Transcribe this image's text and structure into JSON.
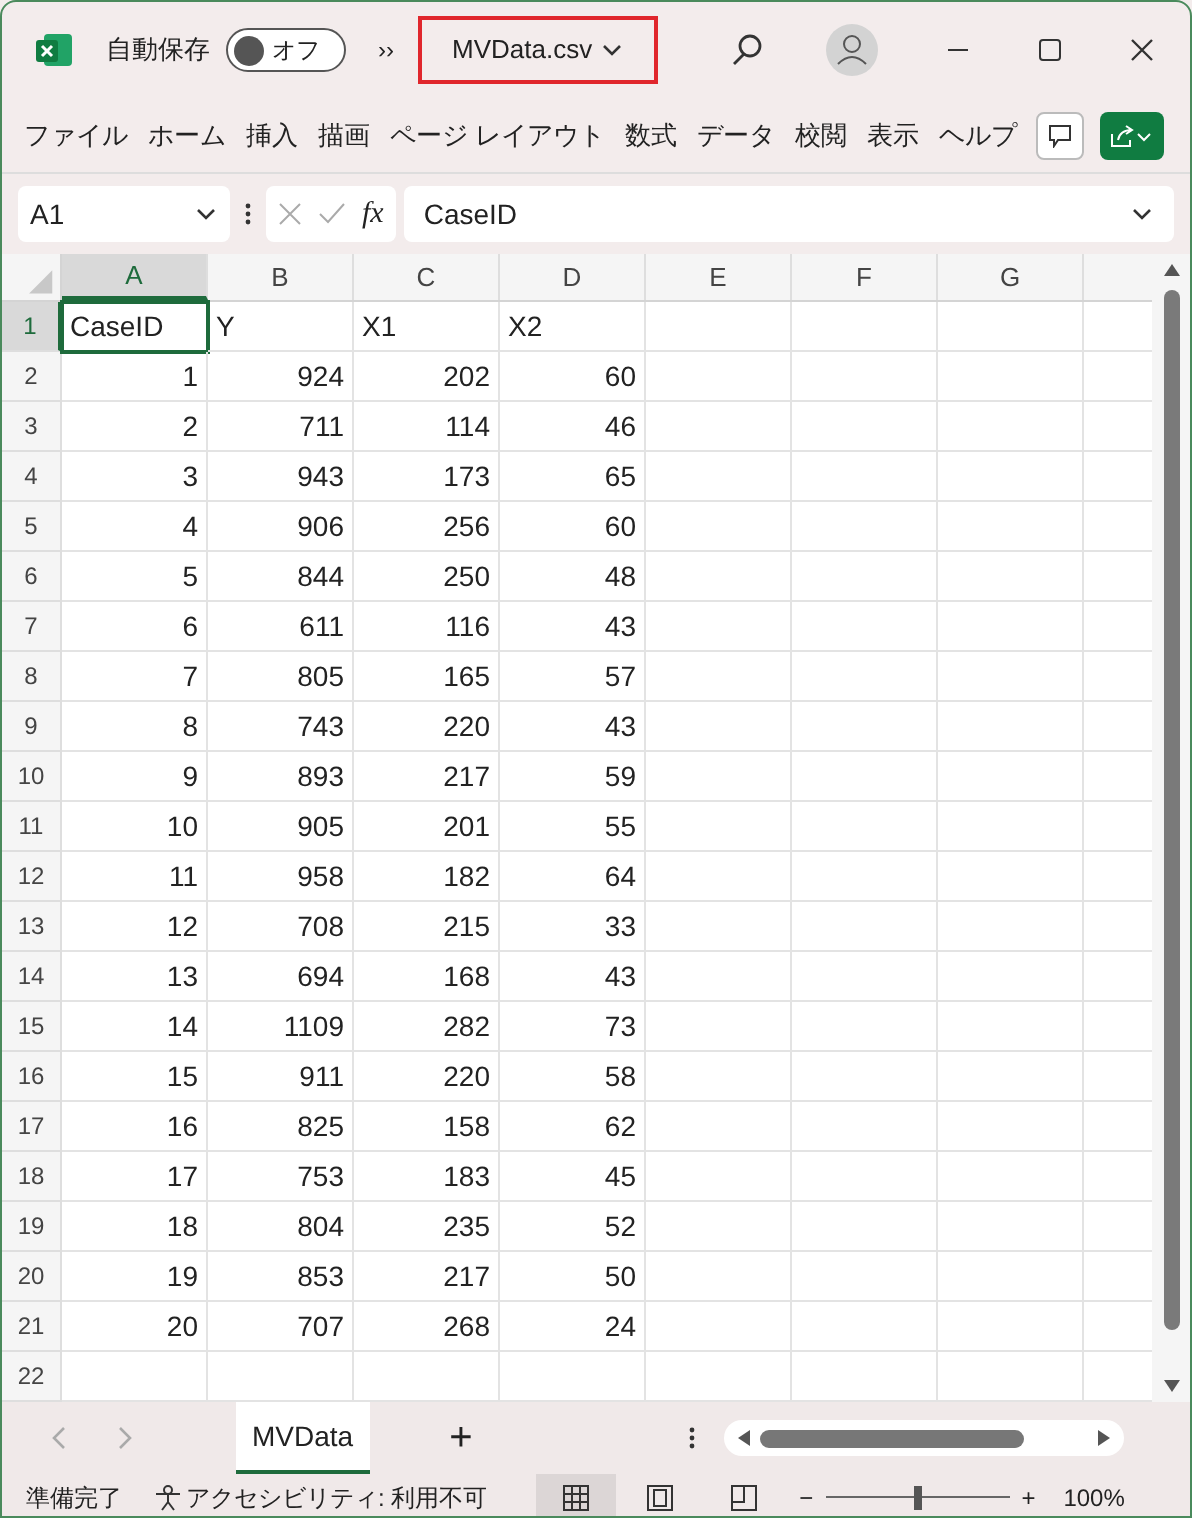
{
  "title_bar": {
    "autosave": {
      "label": "自動保存",
      "state_text": "オフ",
      "on": false
    },
    "overflow": "››",
    "file_name": "MVData.csv"
  },
  "ribbon_tabs": [
    {
      "label": "ファイル"
    },
    {
      "label": "ホーム"
    },
    {
      "label": "挿入"
    },
    {
      "label": "描画"
    },
    {
      "label": "ページ レイアウト"
    },
    {
      "label": "数式"
    },
    {
      "label": "データ"
    },
    {
      "label": "校閲"
    },
    {
      "label": "表示"
    },
    {
      "label": "ヘルプ"
    }
  ],
  "formula_bar": {
    "name_box": "A1",
    "fx": "fx",
    "formula": "CaseID"
  },
  "columns": [
    {
      "label": "A",
      "selected": true
    },
    {
      "label": "B",
      "selected": false
    },
    {
      "label": "C",
      "selected": false
    },
    {
      "label": "D",
      "selected": false
    },
    {
      "label": "E",
      "selected": false
    },
    {
      "label": "F",
      "selected": false
    },
    {
      "label": "G",
      "selected": false
    }
  ],
  "rows": [
    {
      "header": "1",
      "selected": true,
      "kind": "text",
      "cells": [
        "CaseID",
        "Y",
        "X1",
        "X2"
      ]
    },
    {
      "header": "2",
      "selected": false,
      "kind": "number",
      "cells": [
        "1",
        "924",
        "202",
        "60"
      ]
    },
    {
      "header": "3",
      "selected": false,
      "kind": "number",
      "cells": [
        "2",
        "711",
        "114",
        "46"
      ]
    },
    {
      "header": "4",
      "selected": false,
      "kind": "number",
      "cells": [
        "3",
        "943",
        "173",
        "65"
      ]
    },
    {
      "header": "5",
      "selected": false,
      "kind": "number",
      "cells": [
        "4",
        "906",
        "256",
        "60"
      ]
    },
    {
      "header": "6",
      "selected": false,
      "kind": "number",
      "cells": [
        "5",
        "844",
        "250",
        "48"
      ]
    },
    {
      "header": "7",
      "selected": false,
      "kind": "number",
      "cells": [
        "6",
        "611",
        "116",
        "43"
      ]
    },
    {
      "header": "8",
      "selected": false,
      "kind": "number",
      "cells": [
        "7",
        "805",
        "165",
        "57"
      ]
    },
    {
      "header": "9",
      "selected": false,
      "kind": "number",
      "cells": [
        "8",
        "743",
        "220",
        "43"
      ]
    },
    {
      "header": "10",
      "selected": false,
      "kind": "number",
      "cells": [
        "9",
        "893",
        "217",
        "59"
      ]
    },
    {
      "header": "11",
      "selected": false,
      "kind": "number",
      "cells": [
        "10",
        "905",
        "201",
        "55"
      ]
    },
    {
      "header": "12",
      "selected": false,
      "kind": "number",
      "cells": [
        "11",
        "958",
        "182",
        "64"
      ]
    },
    {
      "header": "13",
      "selected": false,
      "kind": "number",
      "cells": [
        "12",
        "708",
        "215",
        "33"
      ]
    },
    {
      "header": "14",
      "selected": false,
      "kind": "number",
      "cells": [
        "13",
        "694",
        "168",
        "43"
      ]
    },
    {
      "header": "15",
      "selected": false,
      "kind": "number",
      "cells": [
        "14",
        "1109",
        "282",
        "73"
      ]
    },
    {
      "header": "16",
      "selected": false,
      "kind": "number",
      "cells": [
        "15",
        "911",
        "220",
        "58"
      ]
    },
    {
      "header": "17",
      "selected": false,
      "kind": "number",
      "cells": [
        "16",
        "825",
        "158",
        "62"
      ]
    },
    {
      "header": "18",
      "selected": false,
      "kind": "number",
      "cells": [
        "17",
        "753",
        "183",
        "45"
      ]
    },
    {
      "header": "19",
      "selected": false,
      "kind": "number",
      "cells": [
        "18",
        "804",
        "235",
        "52"
      ]
    },
    {
      "header": "20",
      "selected": false,
      "kind": "number",
      "cells": [
        "19",
        "853",
        "217",
        "50"
      ]
    },
    {
      "header": "21",
      "selected": false,
      "kind": "number",
      "cells": [
        "20",
        "707",
        "268",
        "24"
      ]
    },
    {
      "header": "22",
      "selected": false,
      "kind": "number",
      "cells": []
    }
  ],
  "sheet_tabs": [
    {
      "label": "MVData",
      "selected": true
    }
  ],
  "add_sheet": "+",
  "status_bar": {
    "ready": "準備完了",
    "accessibility": "アクセシビリティ: 利用不可",
    "views": [
      {
        "kind": "normal",
        "selected": true
      },
      {
        "kind": "page_layout",
        "selected": false
      },
      {
        "kind": "page_break",
        "selected": false
      }
    ],
    "zoom_minus": "−",
    "zoom_plus": "+",
    "zoom": {
      "level": 0.5
    },
    "zoom_text": "100%"
  }
}
